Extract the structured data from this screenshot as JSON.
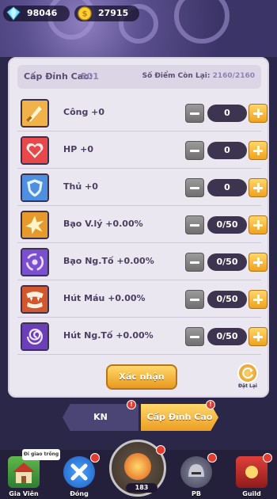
{
  "resources": {
    "gems": "98046",
    "gold": "27915"
  },
  "header": {
    "level_label": "Cấp Đỉnh Cao:",
    "level_value": "501",
    "points_label": "Số Điểm Còn Lại:",
    "points_value": "2160/2160"
  },
  "stats": [
    {
      "label": "Công +0",
      "value": "0",
      "icon": "sword-icon"
    },
    {
      "label": "HP +0",
      "value": "0",
      "icon": "heart-icon"
    },
    {
      "label": "Thủ +0",
      "value": "0",
      "icon": "shield-icon"
    },
    {
      "label": "Bạo V.lý +0.00%",
      "value": "0/50",
      "icon": "burst-icon"
    },
    {
      "label": "Bạo Ng.Tố +0.00%",
      "value": "0/50",
      "icon": "vortex-icon"
    },
    {
      "label": "Hút Máu +0.00%",
      "value": "0/50",
      "icon": "fang-icon"
    },
    {
      "label": "Hút Ng.Tố +0.00%",
      "value": "0/50",
      "icon": "spiral-icon"
    }
  ],
  "actions": {
    "confirm": "Xác nhận",
    "reset": "Đặt Lại"
  },
  "tabs": {
    "kn": "KN",
    "peak": "Cấp Đỉnh Cao"
  },
  "nav": {
    "tooltip": "Đi giao trống",
    "items": [
      {
        "label": "Gia Viên"
      },
      {
        "label": "Đóng"
      },
      {
        "label": "183"
      },
      {
        "label": "PB"
      },
      {
        "label": "Guild"
      }
    ]
  },
  "colors": {
    "accent": "#f0a21e",
    "panel": "#ebe7f0",
    "dark": "#2b2748"
  }
}
